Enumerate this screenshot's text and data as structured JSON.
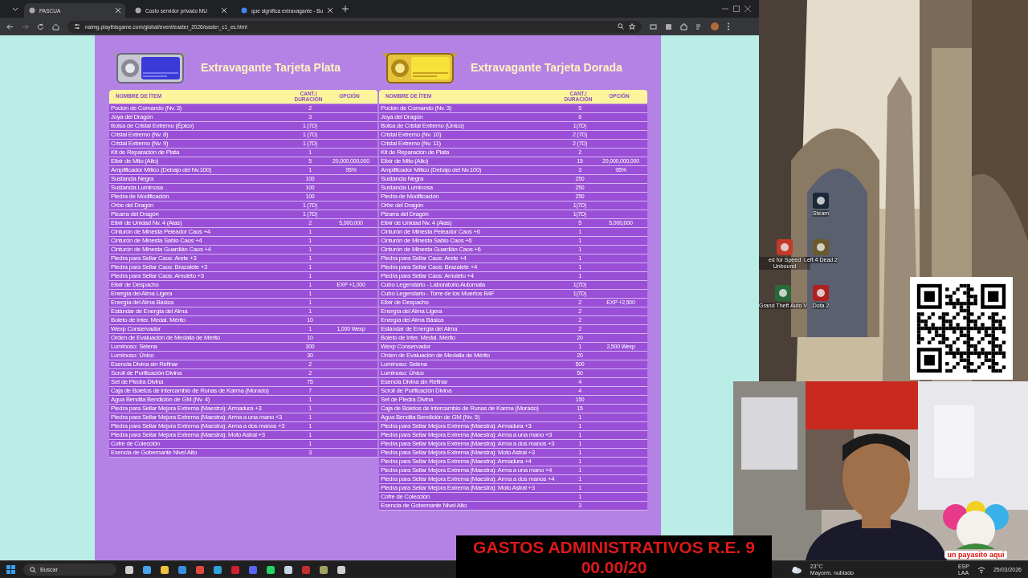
{
  "browser": {
    "tabs": [
      {
        "title": "PASCUA",
        "selected": true
      },
      {
        "title": "Costo servidor privado MU",
        "selected": false
      },
      {
        "title": "que significa extravagante - Bu",
        "selected": false
      }
    ],
    "url": "naimg.playthisgame.com/global/event/easter_2026/easter_c1_es.html"
  },
  "cards": [
    {
      "kind": "silver",
      "title": "Extravagante Tarjeta Plata",
      "columns": [
        "NOMBRE DE ÍTEM",
        "CANT./ DURACIÓN",
        "OPCIÓN"
      ],
      "rows": [
        {
          "name": "Poción de Comando (Nv. 3)",
          "qty": "2"
        },
        {
          "name": "Joya del Dragón",
          "qty": "3"
        },
        {
          "name": "Bolsa de Cristal Extremo (Épico)",
          "qty": "1 (7D)"
        },
        {
          "name": "Cristal Extremo (Nv. 8)",
          "qty": "1 (7D)"
        },
        {
          "name": "Cristal Extremo (Nv. 9)",
          "qty": "1 (7D)"
        },
        {
          "name": "Kit de Reparación de Plata",
          "qty": "1"
        },
        {
          "name": "Elixir de Mito (Alto)",
          "qty": "5",
          "option": "20,000,000,000"
        },
        {
          "name": "Amplificador Mítico (Debajo del Nv.100)",
          "qty": "1",
          "option": "95%"
        },
        {
          "name": "Sustancia Negra",
          "qty": "100"
        },
        {
          "name": "Sustancia Luminosa",
          "qty": "100"
        },
        {
          "name": "Piedra de Modificación",
          "qty": "100"
        },
        {
          "name": "Orbe del Dragón",
          "qty": "1 (7D)"
        },
        {
          "name": "Pizarra del Dragón",
          "qty": "1 (7D)"
        },
        {
          "name": "Elixir de Unidad Nv. 4 (Alas)",
          "qty": "2",
          "option": "5,000,000"
        },
        {
          "name": "Cinturón de Minesta Peleador Caos +4",
          "qty": "1"
        },
        {
          "name": "Cinturón de Minesta Sabio Caos +4",
          "qty": "1"
        },
        {
          "name": "Cinturón de Minesta Guardián Caos +4",
          "qty": "1"
        },
        {
          "name": "Piedra para Sellar Caos: Arete +3",
          "qty": "1"
        },
        {
          "name": "Piedra para Sellar Caos: Brazalete +3",
          "qty": "1"
        },
        {
          "name": "Piedra para Sellar Caos: Amuleto +3",
          "qty": "1"
        },
        {
          "name": "Elixir de Despacho",
          "qty": "1",
          "option": "EXP +1,000"
        },
        {
          "name": "Energía del Alma Ligera",
          "qty": "1"
        },
        {
          "name": "Energía del Alma Básica",
          "qty": "1"
        },
        {
          "name": "Estándar de Energía del Alma",
          "qty": "1"
        },
        {
          "name": "Boleto de Inter. Medal. Mérito",
          "qty": "10"
        },
        {
          "name": "Wexp Conservador",
          "qty": "1",
          "option": "1,000 Wexp"
        },
        {
          "name": "Orden de Evaluación de Medalla de Mérito",
          "qty": "10"
        },
        {
          "name": "Luminoso: Selena",
          "qty": "300"
        },
        {
          "name": "Luminoso: Único",
          "qty": "30"
        },
        {
          "name": "Esencia Divina sin Refinar",
          "qty": "2"
        },
        {
          "name": "Scroll de Purificación Divina",
          "qty": "2"
        },
        {
          "name": "Set de Piedra Divina",
          "qty": "75"
        },
        {
          "name": "Caja de Boletos de intercambio de Runas de Karma (Morado)",
          "qty": "7"
        },
        {
          "name": "Agua Bendita Bendición de GM (Nv. 4)",
          "qty": "1"
        },
        {
          "name": "Piedra para Sellar Mejora Extrema (Maestra): Armadura +3",
          "qty": "1"
        },
        {
          "name": "Piedra para Sellar Mejora Extrema (Maestra): Arma a una mano +3",
          "qty": "1"
        },
        {
          "name": "Piedra para Sellar Mejora Extrema (Maestra): Arma a dos manos +3",
          "qty": "1"
        },
        {
          "name": "Piedra para Sellar Mejora Extrema (Maestra): Moto Astral +3",
          "qty": "1"
        },
        {
          "name": "Cofre de Colección",
          "qty": "1"
        },
        {
          "name": "Esencia de Gobernante Nivel Alto",
          "qty": "3"
        }
      ]
    },
    {
      "kind": "gold",
      "title": "Extravagante Tarjeta Dorada",
      "columns": [
        "NOMBRE DE ÍTEM",
        "CANT./ DURACIÓN",
        "OPCIÓN"
      ],
      "rows": [
        {
          "name": "Poción de Comando (Nv. 3)",
          "qty": "5"
        },
        {
          "name": "Joya del Dragón",
          "qty": "6"
        },
        {
          "name": "Bolsa de Cristal Extremo (Único)",
          "qty": "1(7D)"
        },
        {
          "name": "Cristal Extremo (Nv. 10)",
          "qty": "2 (7D)"
        },
        {
          "name": "Cristal Extremo (Nv. 11)",
          "qty": "2 (7D)"
        },
        {
          "name": "Kit de Reparación de Plata",
          "qty": "2"
        },
        {
          "name": "Elixir de Mito (Alto)",
          "qty": "15",
          "option": "20,000,000,000"
        },
        {
          "name": "Amplificador Mítico (Debajo del Nv.100)",
          "qty": "3",
          "option": "95%"
        },
        {
          "name": "Sustancia Negra",
          "qty": "250"
        },
        {
          "name": "Sustancia Luminosa",
          "qty": "250"
        },
        {
          "name": "Piedra de Modificación",
          "qty": "250"
        },
        {
          "name": "Orbe del Dragón",
          "qty": "1(7D)"
        },
        {
          "name": "Pizarra del Dragón",
          "qty": "1(7D)"
        },
        {
          "name": "Elixir de Unidad Nv. 4 (Alas)",
          "qty": "5",
          "option": "5,000,000"
        },
        {
          "name": "Cinturón de Minesta Peleador Caos +6",
          "qty": "1"
        },
        {
          "name": "Cinturón de Minesta Sabio Caos +6",
          "qty": "1"
        },
        {
          "name": "Cinturón de Minesta Guardián Caos +6",
          "qty": "1"
        },
        {
          "name": "Piedra para Sellar Caos: Arete +4",
          "qty": "1"
        },
        {
          "name": "Piedra para Sellar Caos: Brazalete +4",
          "qty": "1"
        },
        {
          "name": "Piedra para Sellar Caos: Amuleto +4",
          "qty": "1"
        },
        {
          "name": "Cubo Legendario - Laboratorio Automata",
          "qty": "1(7D)"
        },
        {
          "name": "Cubo Legendario - Torre de los Muertos B4F",
          "qty": "1(7D)"
        },
        {
          "name": "Elixir de Despacho",
          "qty": "2",
          "option": "EXP +2,500"
        },
        {
          "name": "Energía del Alma Ligera",
          "qty": "2"
        },
        {
          "name": "Energía del Alma Básica",
          "qty": "2"
        },
        {
          "name": "Estándar de Energía del Alma",
          "qty": "2"
        },
        {
          "name": "Boleto de Inter. Medal. Mérito",
          "qty": "20"
        },
        {
          "name": "Wexp Conservador",
          "qty": "1",
          "option": "2,500 Wexp"
        },
        {
          "name": "Orden de Evaluación de Medalla de Mérito",
          "qty": "20"
        },
        {
          "name": "Luminoso: Selena",
          "qty": "500"
        },
        {
          "name": "Luminoso: Único",
          "qty": "50"
        },
        {
          "name": "Esencia Divina sin Refinar",
          "qty": "4"
        },
        {
          "name": "Scroll de Purificación Divina",
          "qty": "4"
        },
        {
          "name": "Set de Piedra Divina",
          "qty": "150"
        },
        {
          "name": "Caja de Boletos de intercambio de Runas de Karma (Morado)",
          "qty": "15"
        },
        {
          "name": "Agua Bendita Bendición de GM (Nv. 5)",
          "qty": "1"
        },
        {
          "name": "Piedra para Sellar Mejora Extrema (Maestra): Armadura +3",
          "qty": "1"
        },
        {
          "name": "Piedra para Sellar Mejora Extrema (Maestra): Arma a una mano +3",
          "qty": "1"
        },
        {
          "name": "Piedra para Sellar Mejora Extrema (Maestra): Arma a dos manos +3",
          "qty": "1"
        },
        {
          "name": "Piedra para Sellar Mejora Extrema (Maestra): Moto Astral +3",
          "qty": "1"
        },
        {
          "name": "Piedra para Sellar Mejora Extrema (Maestra): Armadura +4",
          "qty": "1"
        },
        {
          "name": "Piedra para Sellar Mejora Extrema (Maestra): Arma a una mano +4",
          "qty": "1"
        },
        {
          "name": "Piedra para Sellar Mejora Extrema (Maestra): Arma a dos manos +4",
          "qty": "1"
        },
        {
          "name": "Piedra para Sellar Mejora Extrema (Maestra): Moto Astral +3",
          "qty": "1"
        },
        {
          "name": "Cofre de Colección",
          "qty": "1"
        },
        {
          "name": "Esencia de Gobernante Nivel Alto",
          "qty": "3"
        }
      ]
    }
  ],
  "desktop": {
    "icons": [
      {
        "label": "Steam"
      },
      {
        "label": "ed for Speed Unbound"
      },
      {
        "label": "Left 4 Dead 2"
      },
      {
        "label": "Grand Theft Auto V"
      },
      {
        "label": "Dota 2"
      }
    ]
  },
  "webcam": {
    "sticker_caption": "un payasito aqui"
  },
  "banner": {
    "lines": [
      "GASTOS ADMINISTRATIVOS R.E. 9",
      "00.00/20"
    ]
  },
  "taskbar": {
    "search_placeholder": "Buscar",
    "weather_temp": "23°C",
    "weather_text": "Mayorm. nublado",
    "language": "ESP",
    "layout": "LAA",
    "date": "25/03/2026"
  }
}
